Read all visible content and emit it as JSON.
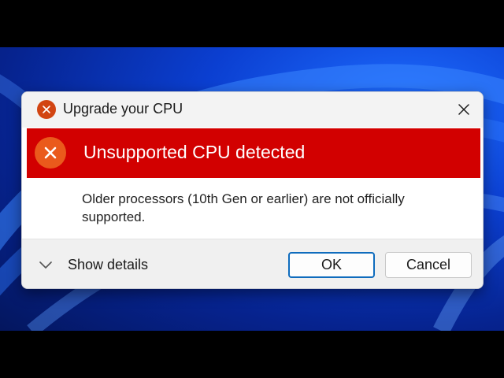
{
  "dialog": {
    "title": "Upgrade your CPU",
    "title_icon": "error-icon",
    "close_icon": "close-icon"
  },
  "banner": {
    "title": "Unsupported CPU detected",
    "icon": "error-icon",
    "color": "#d20000"
  },
  "message": {
    "text": "Older processors (10th Gen or earlier) are not officially supported."
  },
  "footer": {
    "details_label": "Show details",
    "details_icon": "chevron-down-icon",
    "ok_label": "OK",
    "cancel_label": "Cancel"
  },
  "colors": {
    "accent": "#0f6cbd",
    "error_orange": "#ea5a1c"
  }
}
